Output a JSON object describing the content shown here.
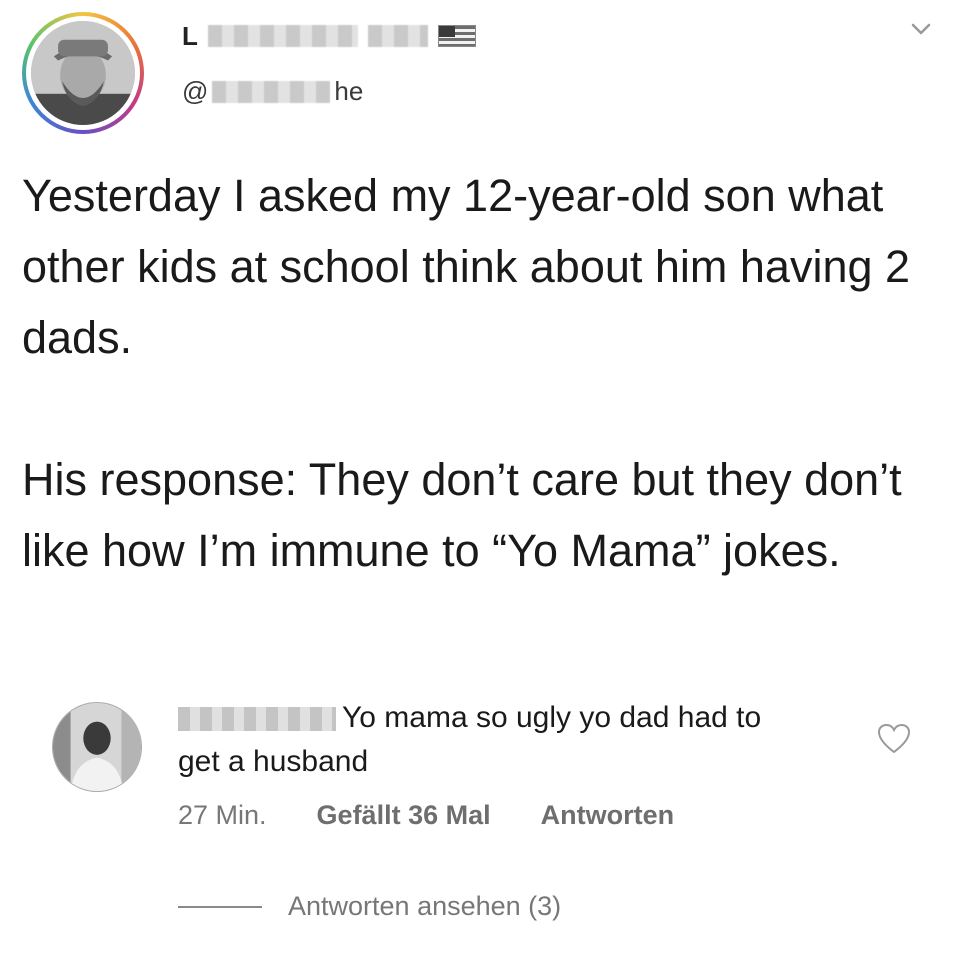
{
  "post": {
    "author": {
      "name_initial": "L",
      "handle_prefix": "@",
      "handle_suffix": "he"
    },
    "paragraphs": [
      "Yesterday I asked my 12-year-old son what other kids at school think about him having 2 dads.",
      "His response: They don’t care but they don’t like how I’m immune to “Yo Mama” jokes."
    ],
    "menu_icon": "chevron-down-icon"
  },
  "comment": {
    "text": "Yo mama so ugly yo dad had to get a husband",
    "time": "27 Min.",
    "likes": "Gefällt 36 Mal",
    "reply_label": "Antworten",
    "like_icon": "heart-icon"
  },
  "replies": {
    "label": "Antworten ansehen (3)"
  },
  "colors": {
    "text": "#1a1a1a",
    "meta": "#777777",
    "ring_gradient": "rainbow"
  }
}
